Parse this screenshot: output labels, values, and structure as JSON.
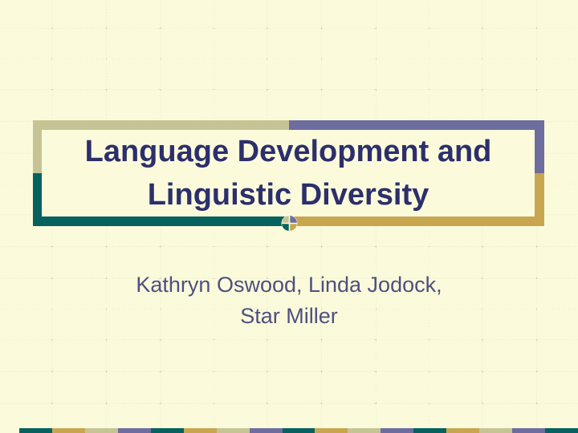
{
  "slide": {
    "title": "Language Development and\nLinguistic Diversity",
    "subtitle": "Kathryn Oswood, Linda Jodock,\nStar Miller"
  },
  "colors": {
    "background": "#fbfbdc",
    "sage": "#c6c495",
    "slate_blue": "#6e6d9f",
    "teal": "#06625f",
    "gold": "#c8a650",
    "title_text": "#2c2f6b",
    "subtitle_text": "#4f4f80"
  }
}
